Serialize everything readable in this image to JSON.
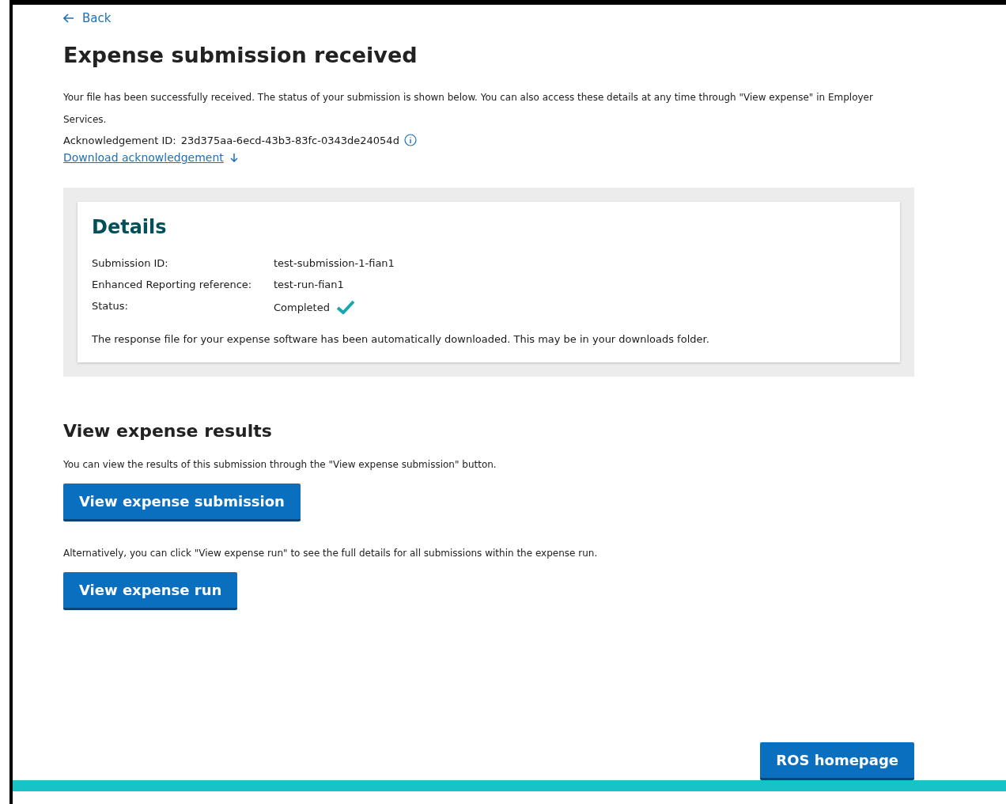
{
  "back_link": "Back",
  "title": "Expense submission received",
  "intro": "Your file has been successfully received. The status of your submission is shown below. You can also access these details at any time through \"View expense\" in Employer Services.",
  "acknowledgement": {
    "label": "Acknowledgement ID:",
    "value": "23d375aa-6ecd-43b3-83fc-0343de24054d"
  },
  "download_link": "Download acknowledgement",
  "details": {
    "title": "Details",
    "rows": [
      {
        "label": "Submission ID:",
        "value": "test-submission-1-fian1",
        "kind": "text"
      },
      {
        "label": "Enhanced Reporting reference:",
        "value": "test-run-fian1",
        "kind": "text"
      },
      {
        "label": "Status:",
        "value": "Completed",
        "kind": "status"
      }
    ],
    "note": "The response file for your expense software has been automatically downloaded. This may be in your downloads folder."
  },
  "results": {
    "title": "View expense results",
    "sections": [
      {
        "text": "You can view the results of this submission through the \"View expense submission\" button.",
        "button": "View expense submission"
      },
      {
        "text": "Alternatively, you can click \"View expense run\" to see the full details for all submissions within the expense run.",
        "button": "View expense run"
      }
    ]
  },
  "home_button": "ROS homepage"
}
